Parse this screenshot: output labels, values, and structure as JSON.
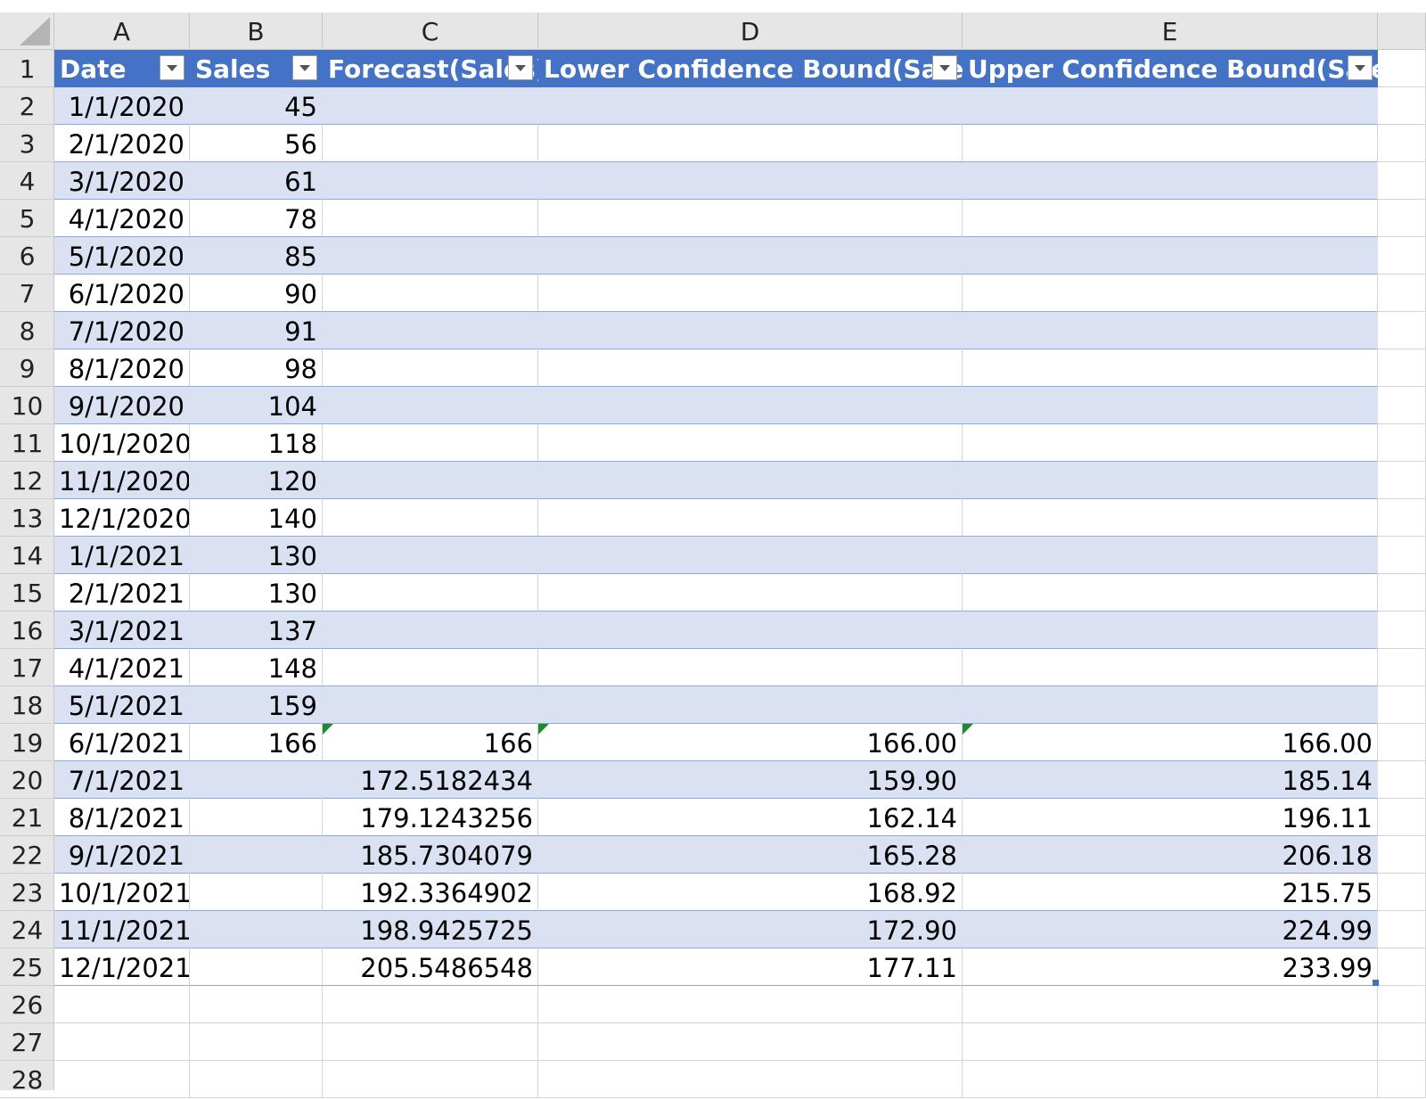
{
  "columns": [
    "A",
    "B",
    "C",
    "D",
    "E"
  ],
  "table": {
    "headers": [
      "Date",
      "Sales",
      "Forecast(Sales)",
      "Lower Confidence Bound(Sales)",
      "Upper Confidence Bound(Sales)"
    ],
    "rows": [
      [
        "1/1/2020",
        "45",
        "",
        "",
        ""
      ],
      [
        "2/1/2020",
        "56",
        "",
        "",
        ""
      ],
      [
        "3/1/2020",
        "61",
        "",
        "",
        ""
      ],
      [
        "4/1/2020",
        "78",
        "",
        "",
        ""
      ],
      [
        "5/1/2020",
        "85",
        "",
        "",
        ""
      ],
      [
        "6/1/2020",
        "90",
        "",
        "",
        ""
      ],
      [
        "7/1/2020",
        "91",
        "",
        "",
        ""
      ],
      [
        "8/1/2020",
        "98",
        "",
        "",
        ""
      ],
      [
        "9/1/2020",
        "104",
        "",
        "",
        ""
      ],
      [
        "10/1/2020",
        "118",
        "",
        "",
        ""
      ],
      [
        "11/1/2020",
        "120",
        "",
        "",
        ""
      ],
      [
        "12/1/2020",
        "140",
        "",
        "",
        ""
      ],
      [
        "1/1/2021",
        "130",
        "",
        "",
        ""
      ],
      [
        "2/1/2021",
        "130",
        "",
        "",
        ""
      ],
      [
        "3/1/2021",
        "137",
        "",
        "",
        ""
      ],
      [
        "4/1/2021",
        "148",
        "",
        "",
        ""
      ],
      [
        "5/1/2021",
        "159",
        "",
        "",
        ""
      ],
      [
        "6/1/2021",
        "166",
        "166",
        "166.00",
        "166.00"
      ],
      [
        "7/1/2021",
        "",
        "172.5182434",
        "159.90",
        "185.14"
      ],
      [
        "8/1/2021",
        "",
        "179.1243256",
        "162.14",
        "196.11"
      ],
      [
        "9/1/2021",
        "",
        "185.7304079",
        "165.28",
        "206.18"
      ],
      [
        "10/1/2021",
        "",
        "192.3364902",
        "168.92",
        "215.75"
      ],
      [
        "11/1/2021",
        "",
        "198.9425725",
        "172.90",
        "224.99"
      ],
      [
        "12/1/2021",
        "",
        "205.5486548",
        "177.11",
        "233.99"
      ]
    ]
  },
  "row_numbers": [
    "1",
    "2",
    "3",
    "4",
    "5",
    "6",
    "7",
    "8",
    "9",
    "10",
    "11",
    "12",
    "13",
    "14",
    "15",
    "16",
    "17",
    "18",
    "19",
    "20",
    "21",
    "22",
    "23",
    "24",
    "25",
    "26",
    "27",
    "28"
  ],
  "colors": {
    "header_fill": "#4472c4",
    "band_fill": "#d9e1f2",
    "band_border": "#8ea9db",
    "error_indicator": "#1e8a2e"
  },
  "icons": {
    "filter_dropdown": "chevron-down-icon",
    "error_indicator": "green-corner-triangle",
    "table_resize": "resize-handle"
  }
}
